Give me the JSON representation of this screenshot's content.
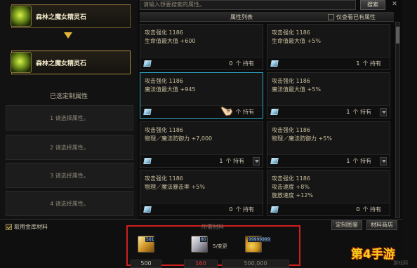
{
  "left": {
    "item_top_name": "森林之魔女精灵石",
    "item_bottom_name": "森林之魔女精灵石",
    "selected_title": "已选定制属性",
    "slots": [
      {
        "label": "1 请选择属性。"
      },
      {
        "label": "2 请选择属性。"
      },
      {
        "label": "3 请选择属性。"
      },
      {
        "label": "4 请选择属性。"
      }
    ]
  },
  "search": {
    "placeholder": "请输入想要搜索的属性。",
    "button_label": "搜索",
    "close_label": "✕"
  },
  "list": {
    "title": "属性列表",
    "only_owned_label": "仅查看已有属性",
    "cards": [
      {
        "line1": "攻击强化 1186",
        "line2": "生命值最大值 +600",
        "line3": "",
        "count": "0",
        "own_text": "个 持有"
      },
      {
        "line1": "攻击强化 1186",
        "line2": "生命值最大值 +5%",
        "line3": "",
        "count": "1",
        "own_text": "个 持有"
      },
      {
        "line1": "攻击强化 1186",
        "line2": "魔法值最大值 +945",
        "line3": "",
        "count": "0",
        "own_text": "个 持有"
      },
      {
        "line1": "攻击强化 1186",
        "line2": "魔法值最大值 +5%",
        "line3": "",
        "count": "1",
        "own_text": "个 持有"
      },
      {
        "line1": "攻击强化 1186",
        "line2": "物理／魔法防御力 +7,000",
        "line3": "",
        "count": "1",
        "own_text": "个 持有"
      },
      {
        "line1": "攻击强化 1186",
        "line2": "物理／魔法防御力 +5%",
        "line3": "",
        "count": "1",
        "own_text": "个 持有"
      },
      {
        "line1": "攻击强化 1186",
        "line2": "物理／魔法暴击率 +5%",
        "line3": "",
        "count": "0",
        "own_text": "个 持有"
      },
      {
        "line1": "攻击强化 1186",
        "line2": "攻击速度 +8%",
        "line3": "施放速度 +12%",
        "count": "0",
        "own_text": "个 持有"
      }
    ]
  },
  "bottom": {
    "use_storage_label": "取用金库材料",
    "materials_title": "所需材料",
    "guide_button": "定制图鉴",
    "shop_button": "材料商店",
    "materials": [
      {
        "icon": "gold-crystal-icon",
        "owned_num": "561",
        "required": "500"
      },
      {
        "icon": "silver-ore-icon",
        "owned_num": "80",
        "extra": "5/变更",
        "required": "160"
      },
      {
        "icon": "gold-coins-icon",
        "owned_num": "99999999",
        "required": "500,000"
      }
    ]
  },
  "watermark": {
    "main": "第4手游",
    "sub": "游戏网"
  },
  "colors": {
    "selected_border": "#2fa7c7",
    "highlight_frame": "#d21d1d",
    "insufficient": "#e23a3a"
  }
}
